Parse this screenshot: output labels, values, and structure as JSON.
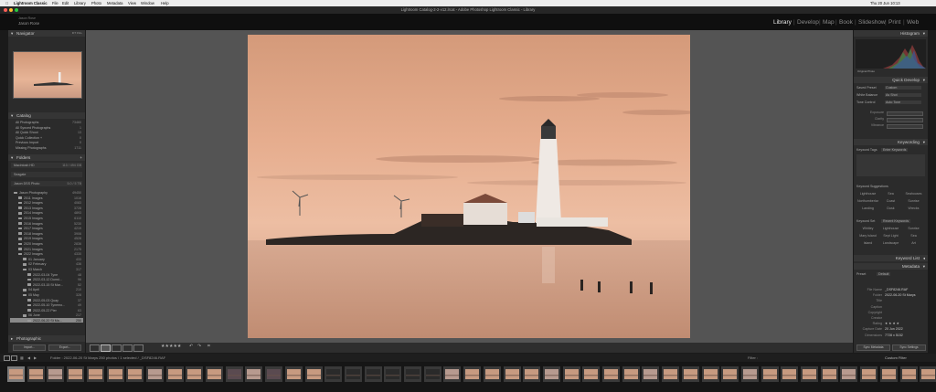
{
  "menubar": {
    "apple": "",
    "app": "Lightroom Classic",
    "items": [
      "File",
      "Edit",
      "Library",
      "Photo",
      "Metadata",
      "View",
      "Window",
      "Help"
    ],
    "datetime": "Thu 20 Jun  10:13"
  },
  "window": {
    "title": "Lightroom Catalog-2-2-v12.lrcat - Adobe Photoshop Lightroom Classic - Library"
  },
  "identity": {
    "line1": "Jason Rose",
    "line2": "Jason Rose"
  },
  "modules": [
    "Library",
    "Develop",
    "Map",
    "Book",
    "Slideshow",
    "Print",
    "Web"
  ],
  "active_module": "Library",
  "left": {
    "navigator": {
      "title": "Navigator",
      "zoom": "FIT  FILL"
    },
    "catalog": {
      "title": "Catalog",
      "items": [
        {
          "label": "All Photographs",
          "count": "73460"
        },
        {
          "label": "All Synced Photographs",
          "count": "1"
        },
        {
          "label": "All Quick Shoot",
          "count": "13"
        },
        {
          "label": "Quick Collection +",
          "count": "0"
        },
        {
          "label": "Previous Import",
          "count": "0"
        },
        {
          "label": "Missing Photographs",
          "count": "1711"
        }
      ]
    },
    "folders": {
      "title": "Folders",
      "volumes": [
        {
          "label": "Macintosh HD",
          "value": "110 / 494 GB"
        },
        {
          "label": "Seagate",
          "value": ""
        },
        {
          "label": "Jason DSS Photo",
          "value": "5.0 / 5 TB"
        }
      ],
      "tree": [
        {
          "label": "Jason Photography",
          "count": "49450"
        },
        {
          "label": "2011 Images",
          "count": "1016"
        },
        {
          "label": "2012 Images",
          "count": "4083"
        },
        {
          "label": "2013 Images",
          "count": "3728"
        },
        {
          "label": "2014 Images",
          "count": "4893"
        },
        {
          "label": "2015 Images",
          "count": "6110"
        },
        {
          "label": "2016 Images",
          "count": "5230"
        },
        {
          "label": "2017 Images",
          "count": "4219"
        },
        {
          "label": "2018 Images",
          "count": "3906"
        },
        {
          "label": "2019 Images",
          "count": "4528"
        },
        {
          "label": "2020 Images",
          "count": "2836"
        },
        {
          "label": "2021 Images",
          "count": "2175"
        },
        {
          "label": "2022 Images",
          "count": "4330"
        },
        {
          "label": "01 January",
          "count": "433"
        },
        {
          "label": "02 February",
          "count": "436"
        },
        {
          "label": "03 March",
          "count": "317"
        },
        {
          "label": "2022-03-04 Tyne",
          "count": "48"
        },
        {
          "label": "2022-03-12 Dunst...",
          "count": "96"
        },
        {
          "label": "2022-03-15 St Mar...",
          "count": "52"
        },
        {
          "label": "04 April",
          "count": "210"
        },
        {
          "label": "05 May",
          "count": "328"
        },
        {
          "label": "2022-05-03 Quay",
          "count": "37"
        },
        {
          "label": "2022-05-10 Tynemo...",
          "count": "49"
        },
        {
          "label": "2022-05-22 Pier",
          "count": "63"
        },
        {
          "label": "06 June",
          "count": "217"
        },
        {
          "label": "2022-06-20 St Ma...",
          "count": "250"
        }
      ]
    },
    "collections_title": "Photographic",
    "import_label": "Import...",
    "export_label": "Export..."
  },
  "right": {
    "histogram": {
      "title": "Histogram",
      "info": "Original Photo"
    },
    "quick_develop": {
      "title": "Quick Develop",
      "rows": [
        {
          "label": "Saved Preset",
          "value": "Custom"
        },
        {
          "label": "White Balance",
          "value": "As Shot"
        },
        {
          "label": "Tone Control",
          "value": "Auto Tone"
        }
      ],
      "sliders": [
        "Exposure",
        "Clarity",
        "Vibrance"
      ]
    },
    "keywording": {
      "title": "Keywording",
      "tags_label": "Keyword Tags",
      "tags_value": "Enter Keywords",
      "suggestions_title": "Keyword Suggestions",
      "suggestions": [
        "Lighthouse",
        "Sea",
        "Seahouses",
        "Northumberland",
        "Coast",
        "Sunrise",
        "Landing",
        "Dusk",
        "Wrecks"
      ],
      "set_label": "Keyword Set",
      "set_value": "Recent Keywords",
      "set_items": [
        "Whitley",
        "Lighthouse",
        "Sunrise",
        "Mary Island",
        "Sept Light",
        "Sea",
        "Island",
        "Landscape",
        "Art"
      ]
    },
    "keyword_list": {
      "title": "Keyword List"
    },
    "metadata": {
      "title": "Metadata",
      "preset_label": "Preset",
      "preset_value": "Default",
      "fields": [
        {
          "label": "File Name",
          "value": "_DSF8246.RAF"
        },
        {
          "label": "Folder",
          "value": "2022-06-20 St Marys"
        },
        {
          "label": "Title",
          "value": ""
        },
        {
          "label": "Caption",
          "value": ""
        },
        {
          "label": "Copyright",
          "value": ""
        },
        {
          "label": "Creator",
          "value": ""
        },
        {
          "label": "Rating",
          "value": "★ ★ ★ ★"
        },
        {
          "label": "Capture Date",
          "value": "20 Jun 2022"
        },
        {
          "label": "Dimensions",
          "value": "7728 x 5152"
        }
      ]
    },
    "sync_metadata": "Sync Metadata",
    "sync_settings": "Sync Settings"
  },
  "toolbar": {
    "sort_label": "Sort:",
    "rating_stars": "★★★★★"
  },
  "filmstrip": {
    "info": "Folder : 2022-06-20 St Marys    250 photos / 1 selected / _DSF8246.RAF",
    "filter_label": "Filter :",
    "filter_value": "Custom Filter",
    "thumb_count": 47,
    "selected_index": 0
  },
  "colors": {
    "panel": "#2b2b2b",
    "center": "#545454",
    "sky_top": "#d8a07e",
    "sky_bottom": "#e9b79a",
    "sea": "#caa089"
  }
}
